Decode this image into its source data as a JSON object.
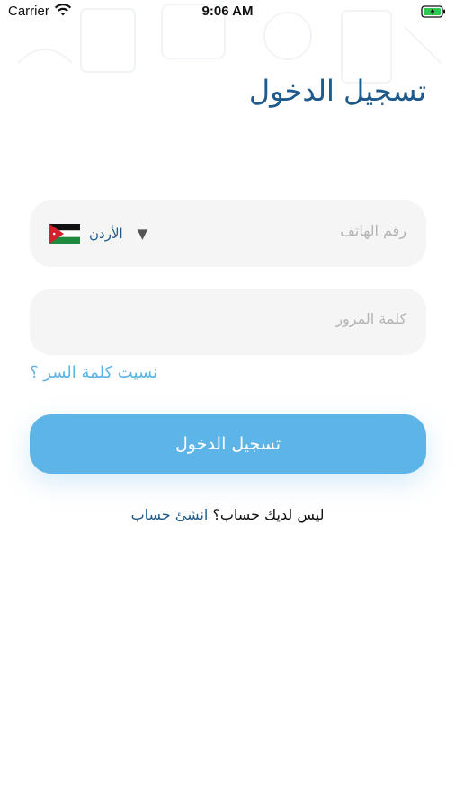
{
  "status_bar": {
    "carrier": "Carrier",
    "time": "9:06 AM"
  },
  "title": "تسجيل الدخول",
  "phone_field": {
    "placeholder": "رقم الهاتف",
    "country_name": "الأردن",
    "flag_icon": "jordan-flag-icon",
    "caret_icon": "caret-down-icon"
  },
  "password_field": {
    "placeholder": "كلمة المرور"
  },
  "forgot_password": "نسيت كلمة السر ؟",
  "login_button": "تسجيل الدخول",
  "signup": {
    "prompt": "ليس لديك حساب؟",
    "link": "انشئ حساب"
  },
  "colors": {
    "accent": "#5db4e6",
    "title": "#1f5a8c",
    "field_bg": "#f5f5f5",
    "placeholder": "#b4b4b4"
  }
}
